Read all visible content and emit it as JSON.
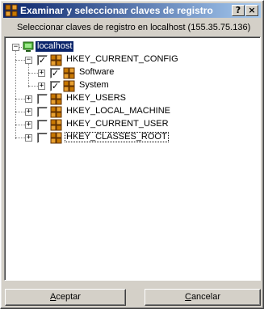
{
  "window": {
    "title": "Examinar y seleccionar claves de registro",
    "icon": "registry-icon",
    "help_label": "?",
    "close_label": "×"
  },
  "header": {
    "label": "Seleccionar claves de registro en localhost (155.35.75.136)"
  },
  "tree": {
    "root": {
      "label": "localhost",
      "icon": "computer-icon",
      "expanded": true,
      "selected": true
    },
    "nodes": [
      {
        "label": "HKEY_CURRENT_CONFIG",
        "checked": true,
        "expanded": true,
        "icon": "registry-key-icon",
        "children": [
          {
            "label": "Software",
            "checked": true,
            "expanded": false,
            "icon": "registry-key-icon"
          },
          {
            "label": "System",
            "checked": true,
            "expanded": false,
            "icon": "registry-key-icon"
          }
        ]
      },
      {
        "label": "HKEY_USERS",
        "checked": false,
        "expanded": false,
        "icon": "registry-key-icon"
      },
      {
        "label": "HKEY_LOCAL_MACHINE",
        "checked": false,
        "expanded": false,
        "icon": "registry-key-icon"
      },
      {
        "label": "HKEY_CURRENT_USER",
        "checked": false,
        "expanded": false,
        "icon": "registry-key-icon"
      },
      {
        "label": "HKEY_CLASSES_ROOT",
        "checked": false,
        "expanded": false,
        "focused": true,
        "icon": "registry-key-icon"
      }
    ]
  },
  "buttons": {
    "ok": {
      "label_before": "",
      "label_accel": "A",
      "label_after": "ceptar"
    },
    "cancel": {
      "label_before": "",
      "label_accel": "C",
      "label_after": "ancelar"
    }
  },
  "colors": {
    "title_start": "#0a246a",
    "title_end": "#a6caf0",
    "selection": "#0a246a",
    "dialog_face": "#d4d0c8"
  }
}
